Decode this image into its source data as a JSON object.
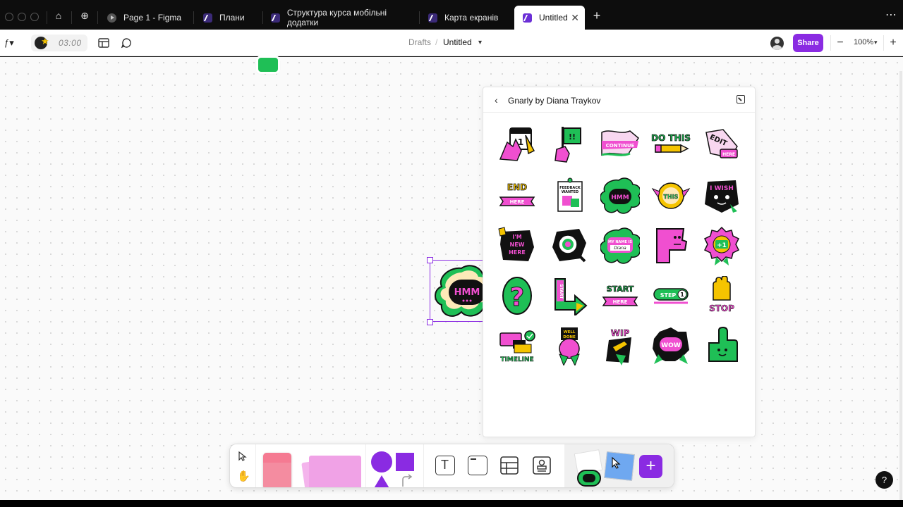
{
  "tabs": [
    {
      "label": "Page 1 - Figma",
      "type": "play"
    },
    {
      "label": "Плани",
      "type": "figjam"
    },
    {
      "label": "Структура курса мобільні додатки",
      "type": "figjam"
    },
    {
      "label": "Карта екранів",
      "type": "figjam"
    },
    {
      "label": "Untitled",
      "type": "figjam",
      "active": true
    }
  ],
  "toolbar": {
    "timer": "03:00",
    "breadcrumb_parent": "Drafts",
    "breadcrumb_sep": "/",
    "file_name": "Untitled",
    "share_label": "Share",
    "zoom": "100%"
  },
  "sticker_panel": {
    "title": "Gnarly by Diana Traykov",
    "stickers": [
      {
        "name": "calendar-hand-1",
        "text": "1"
      },
      {
        "name": "hand-flag",
        "text": "!!"
      },
      {
        "name": "continue-flag",
        "text": "CONTINUE"
      },
      {
        "name": "do-this-pencil",
        "text": "DO THIS"
      },
      {
        "name": "edit-here",
        "text": "EDIT HERE"
      },
      {
        "name": "end-here",
        "text": "END HERE"
      },
      {
        "name": "feedback-wanted",
        "text": "FEEDBACK WANTED"
      },
      {
        "name": "hmm-cloud",
        "text": "HMM"
      },
      {
        "name": "this-sun",
        "text": "THIS"
      },
      {
        "name": "i-wish",
        "text": "I WISH"
      },
      {
        "name": "im-new-here",
        "text": "I'M NEW HERE"
      },
      {
        "name": "eye-magnifier",
        "text": ""
      },
      {
        "name": "my-name-is",
        "text": "MY NAME IS Diana"
      },
      {
        "name": "pink-flag-face",
        "text": ""
      },
      {
        "name": "plus-one-badge",
        "text": "+1"
      },
      {
        "name": "question-mark",
        "text": "?"
      },
      {
        "name": "start-arrow",
        "text": "START"
      },
      {
        "name": "start-here-banner",
        "text": "START HERE"
      },
      {
        "name": "step-one",
        "text": "STEP 1"
      },
      {
        "name": "stop-hand",
        "text": "STOP"
      },
      {
        "name": "timeline",
        "text": "TIMELINE"
      },
      {
        "name": "well-done",
        "text": "WELL DONE"
      },
      {
        "name": "wip",
        "text": "WIP"
      },
      {
        "name": "wow",
        "text": "WOW"
      },
      {
        "name": "thumbs-up",
        "text": ""
      }
    ]
  },
  "canvas": {
    "selected_sticker_text": "HMM"
  },
  "colors": {
    "accent": "#8a2be2",
    "pink": "#f04fd0",
    "green": "#1fbf56",
    "yellow": "#f5c400",
    "black": "#111111"
  },
  "help_label": "?"
}
